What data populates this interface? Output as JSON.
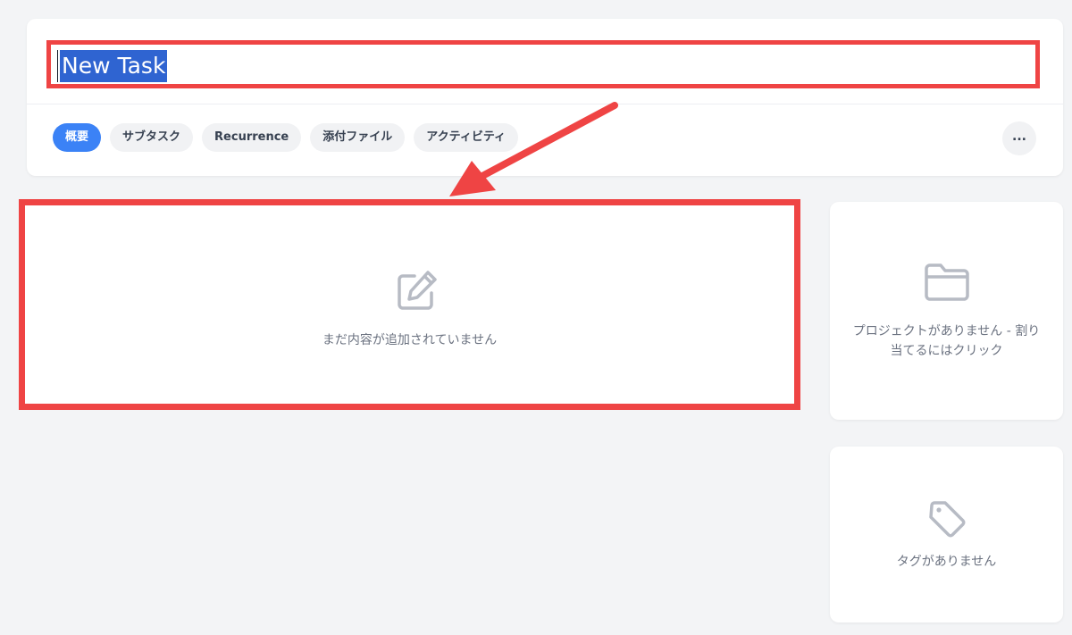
{
  "task": {
    "title": "New Task"
  },
  "tabs": [
    {
      "label": "概要",
      "active": true
    },
    {
      "label": "サブタスク",
      "active": false
    },
    {
      "label": "Recurrence",
      "active": false
    },
    {
      "label": "添付ファイル",
      "active": false
    },
    {
      "label": "アクティビティ",
      "active": false
    }
  ],
  "more_label": "...",
  "content": {
    "icon": "edit-icon",
    "empty_text": "まだ内容が追加されていません"
  },
  "project": {
    "icon": "folder-icon",
    "empty_text": "プロジェクトがありません - 割り当てるにはクリック"
  },
  "tags": {
    "icon": "tag-icon",
    "empty_text": "タグがありません"
  },
  "colors": {
    "accent": "#3b82f6",
    "annotation": "#ef4444",
    "selection": "#2f64d1",
    "background": "#f3f4f6"
  }
}
